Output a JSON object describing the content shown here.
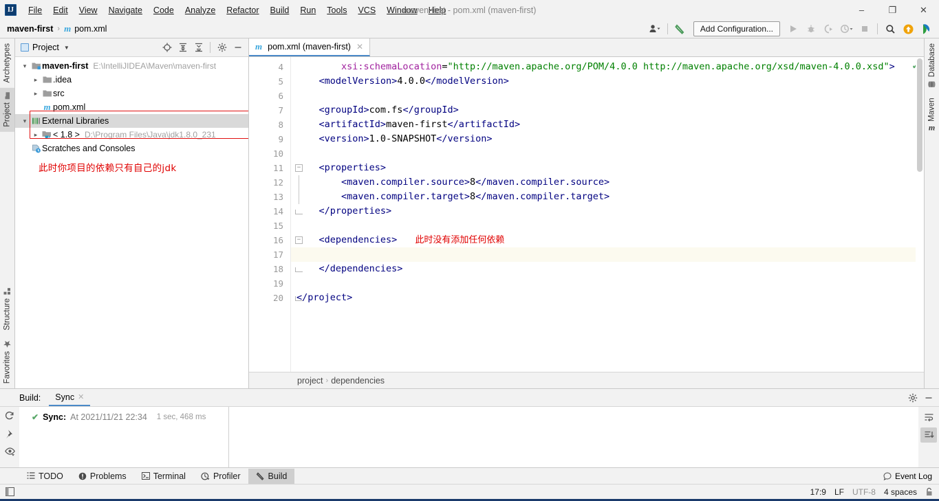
{
  "window": {
    "title": "maven-first - pom.xml (maven-first)",
    "logo_text": "IJ",
    "minimize": "–",
    "maximize": "❐",
    "close": "✕"
  },
  "menubar": {
    "items": [
      {
        "label": "File"
      },
      {
        "label": "Edit"
      },
      {
        "label": "View"
      },
      {
        "label": "Navigate"
      },
      {
        "label": "Code"
      },
      {
        "label": "Analyze"
      },
      {
        "label": "Refactor"
      },
      {
        "label": "Build"
      },
      {
        "label": "Run"
      },
      {
        "label": "Tools"
      },
      {
        "label": "VCS"
      },
      {
        "label": "Window"
      },
      {
        "label": "Help"
      }
    ]
  },
  "navbar": {
    "breadcrumb": [
      {
        "label": "maven-first",
        "bold": true
      },
      {
        "label": "pom.xml",
        "bold": false,
        "icon": "m"
      }
    ],
    "separator": "›",
    "add_configuration": "Add Configuration...",
    "icons": [
      "user-icon",
      "hammer-icon",
      "run-icon",
      "debug-icon",
      "run-coverage-icon",
      "profile-icon",
      "stop-icon",
      "search-everywhere-icon",
      "update-icon",
      "ide-icon"
    ]
  },
  "left_strip": {
    "top": [
      {
        "label": "Archetypes",
        "selected": false
      },
      {
        "label": "Project",
        "selected": true,
        "icon": "folder-icon"
      }
    ],
    "bottom": [
      {
        "label": "Structure",
        "selected": false,
        "icon": "structure-icon"
      },
      {
        "label": "Favorites",
        "selected": false,
        "icon": "star-icon"
      }
    ]
  },
  "right_strip": {
    "items": [
      {
        "label": "Database",
        "icon": "database-icon"
      },
      {
        "label": "Maven",
        "icon": "maven-m-icon"
      }
    ]
  },
  "project_panel": {
    "title": "Project",
    "tools": [
      "locate-icon",
      "expand-all-icon",
      "collapse-all-icon",
      "settings-gear-icon",
      "minimize-icon"
    ],
    "tree": [
      {
        "depth": 0,
        "twisty": "⌄",
        "icon": "module-folder-icon",
        "label": "maven-first",
        "bold": true,
        "path": "E:\\IntelliJIDEA\\Maven\\maven-first",
        "selected": false
      },
      {
        "depth": 1,
        "twisty": "›",
        "icon": "folder-icon",
        "label": ".idea",
        "bold": false,
        "path": "",
        "selected": false
      },
      {
        "depth": 1,
        "twisty": "›",
        "icon": "folder-icon",
        "label": "src",
        "bold": false,
        "path": "",
        "selected": false
      },
      {
        "depth": 1,
        "twisty": "",
        "icon": "maven-m-icon",
        "label": "pom.xml",
        "bold": false,
        "path": "",
        "selected": false
      },
      {
        "depth": 0,
        "twisty": "⌄",
        "icon": "libraries-icon",
        "label": "External Libraries",
        "bold": false,
        "path": "",
        "selected": true
      },
      {
        "depth": 1,
        "twisty": "›",
        "icon": "jdk-icon",
        "label": "< 1.8 >",
        "bold": false,
        "path": "D:\\Program Files\\Java\\jdk1.8.0_231",
        "selected": false
      },
      {
        "depth": 0,
        "twisty": "",
        "icon": "scratches-icon",
        "label": "Scratches and Consoles",
        "bold": false,
        "path": "",
        "selected": false
      }
    ],
    "annotation": "此时你项目的依赖只有自己的jdk",
    "highlight_color": "#e01010"
  },
  "editor": {
    "tab": {
      "label": "pom.xml (maven-first)",
      "icon": "maven-m-icon",
      "close": "✕"
    },
    "inspection_status": "✔",
    "inline_note": "此时没有添加任何依赖",
    "current_line": 17,
    "lines": [
      {
        "num": 4,
        "fold": "",
        "segments": [
          {
            "t": "        ",
            "c": "txt"
          },
          {
            "t": "xsi:schemaLocation",
            "c": "attr"
          },
          {
            "t": "=",
            "c": "txt"
          },
          {
            "t": "\"http://maven.apache.org/POM/4.0.0 http://maven.apache.org/xsd/maven-4.0.0.xsd\"",
            "c": "str"
          },
          {
            "t": ">",
            "c": "tg"
          }
        ]
      },
      {
        "num": 5,
        "fold": "",
        "segments": [
          {
            "t": "    ",
            "c": "txt"
          },
          {
            "t": "<modelVersion>",
            "c": "tg"
          },
          {
            "t": "4.0.0",
            "c": "txt"
          },
          {
            "t": "</modelVersion>",
            "c": "tg"
          }
        ]
      },
      {
        "num": 6,
        "fold": "",
        "segments": []
      },
      {
        "num": 7,
        "fold": "",
        "segments": [
          {
            "t": "    ",
            "c": "txt"
          },
          {
            "t": "<groupId>",
            "c": "tg"
          },
          {
            "t": "com.fs",
            "c": "txt"
          },
          {
            "t": "</groupId>",
            "c": "tg"
          }
        ]
      },
      {
        "num": 8,
        "fold": "",
        "segments": [
          {
            "t": "    ",
            "c": "txt"
          },
          {
            "t": "<artifactId>",
            "c": "tg"
          },
          {
            "t": "maven-first",
            "c": "txt"
          },
          {
            "t": "</artifactId>",
            "c": "tg"
          }
        ]
      },
      {
        "num": 9,
        "fold": "",
        "segments": [
          {
            "t": "    ",
            "c": "txt"
          },
          {
            "t": "<version>",
            "c": "tg"
          },
          {
            "t": "1.0-SNAPSHOT",
            "c": "txt"
          },
          {
            "t": "</version>",
            "c": "tg"
          }
        ]
      },
      {
        "num": 10,
        "fold": "",
        "segments": []
      },
      {
        "num": 11,
        "fold": "minus",
        "segments": [
          {
            "t": "    ",
            "c": "txt"
          },
          {
            "t": "<properties>",
            "c": "tg"
          }
        ]
      },
      {
        "num": 12,
        "fold": "",
        "segments": [
          {
            "t": "        ",
            "c": "txt"
          },
          {
            "t": "<maven.compiler.source>",
            "c": "tg"
          },
          {
            "t": "8",
            "c": "txt"
          },
          {
            "t": "</maven.compiler.source>",
            "c": "tg"
          }
        ]
      },
      {
        "num": 13,
        "fold": "",
        "segments": [
          {
            "t": "        ",
            "c": "txt"
          },
          {
            "t": "<maven.compiler.target>",
            "c": "tg"
          },
          {
            "t": "8",
            "c": "txt"
          },
          {
            "t": "</maven.compiler.target>",
            "c": "tg"
          }
        ]
      },
      {
        "num": 14,
        "fold": "end",
        "segments": [
          {
            "t": "    ",
            "c": "txt"
          },
          {
            "t": "</properties>",
            "c": "tg"
          }
        ]
      },
      {
        "num": 15,
        "fold": "",
        "segments": []
      },
      {
        "num": 16,
        "fold": "minus",
        "segments": [
          {
            "t": "    ",
            "c": "txt"
          },
          {
            "t": "<dependencies>",
            "c": "tg"
          }
        ],
        "note": true
      },
      {
        "num": 17,
        "fold": "",
        "segments": []
      },
      {
        "num": 18,
        "fold": "end",
        "segments": [
          {
            "t": "    ",
            "c": "txt"
          },
          {
            "t": "</dependencies>",
            "c": "tg"
          }
        ]
      },
      {
        "num": 19,
        "fold": "",
        "segments": []
      },
      {
        "num": 20,
        "fold": "end",
        "segments": [
          {
            "t": "</project>",
            "c": "tg"
          }
        ]
      }
    ],
    "breadcrumbs": [
      "project",
      "dependencies"
    ],
    "breadcrumb_sep": "›"
  },
  "build_panel": {
    "label": "Build:",
    "tab": {
      "label": "Sync",
      "close": "✕"
    },
    "side_icons": [
      "refresh-icon",
      "pin-icon",
      "eye-icon"
    ],
    "right_icons": [
      "settings-gear-icon",
      "minimize-icon",
      "soft-wrap-icon",
      "scroll-to-end-icon"
    ],
    "tree": [
      {
        "check": "✔",
        "bold": "Sync:",
        "text": "At 2021/11/21 22:34",
        "duration": "1 sec, 468 ms"
      }
    ]
  },
  "bottom_bar": {
    "items": [
      {
        "label": "TODO",
        "icon": "todo-icon",
        "selected": false
      },
      {
        "label": "Problems",
        "icon": "problems-icon",
        "selected": false
      },
      {
        "label": "Terminal",
        "icon": "terminal-icon",
        "selected": false
      },
      {
        "label": "Profiler",
        "icon": "profiler-icon",
        "selected": false
      },
      {
        "label": "Build",
        "icon": "build-hammer-icon",
        "selected": true
      }
    ],
    "event_log": {
      "label": "Event Log",
      "icon": "event-log-icon"
    }
  },
  "status_bar": {
    "caret": "17:9",
    "line_sep": "LF",
    "encoding": "UTF-8",
    "indent": "4 spaces",
    "lock_icon": "read-write-icon",
    "left_icon": "layout-icon"
  }
}
